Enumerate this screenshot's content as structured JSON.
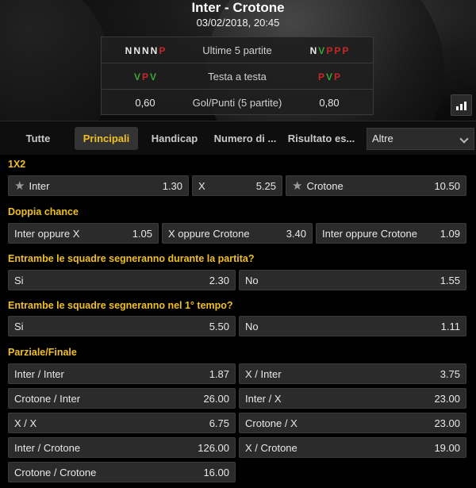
{
  "header": {
    "title": "Inter - Crotone",
    "date": "03/02/2018, 20:45",
    "stats": [
      {
        "label": "Ultime 5 partite",
        "home": [
          "N",
          "N",
          "N",
          "N",
          "P"
        ],
        "away": [
          "N",
          "V",
          "P",
          "P",
          "P"
        ]
      },
      {
        "label": "Testa a testa",
        "home": [
          "V",
          "P",
          "V"
        ],
        "away": [
          "P",
          "V",
          "P"
        ]
      },
      {
        "label": "Gol/Punti (5 partite)",
        "home_value": "0,60",
        "away_value": "0,80"
      }
    ],
    "form_colors": {
      "N": "#e8e8e8",
      "V": "#3aa63a",
      "P": "#c62828"
    }
  },
  "tabs": [
    "Tutte",
    "Principali",
    "Handicap",
    "Numero di ...",
    "Risultato es..."
  ],
  "active_tab": "Principali",
  "select": {
    "value": "Altre"
  },
  "markets": {
    "m1x2": {
      "title": "1X2",
      "options": [
        {
          "name": "Inter",
          "odd": "1.30"
        },
        {
          "name": "X",
          "odd": "5.25"
        },
        {
          "name": "Crotone",
          "odd": "10.50"
        }
      ]
    },
    "doppia": {
      "title": "Doppia chance",
      "options": [
        {
          "name": "Inter oppure X",
          "odd": "1.05"
        },
        {
          "name": "X oppure Crotone",
          "odd": "3.40"
        },
        {
          "name": "Inter oppure Crotone",
          "odd": "1.09"
        }
      ]
    },
    "btts": {
      "title": "Entrambe le squadre segneranno durante la partita?",
      "options": [
        {
          "name": "Si",
          "odd": "2.30"
        },
        {
          "name": "No",
          "odd": "1.55"
        }
      ]
    },
    "btts1": {
      "title": "Entrambe le squadre segneranno nel 1° tempo?",
      "options": [
        {
          "name": "Si",
          "odd": "5.50"
        },
        {
          "name": "No",
          "odd": "1.11"
        }
      ]
    },
    "htft": {
      "title": "Parziale/Finale",
      "options": [
        {
          "name": "Inter / Inter",
          "odd": "1.87"
        },
        {
          "name": "X / Inter",
          "odd": "3.75"
        },
        {
          "name": "Crotone / Inter",
          "odd": "26.00"
        },
        {
          "name": "Inter / X",
          "odd": "23.00"
        },
        {
          "name": "X / X",
          "odd": "6.75"
        },
        {
          "name": "Crotone / X",
          "odd": "23.00"
        },
        {
          "name": "Inter / Crotone",
          "odd": "126.00"
        },
        {
          "name": "X / Crotone",
          "odd": "19.00"
        },
        {
          "name": "Crotone / Crotone",
          "odd": "16.00"
        }
      ]
    }
  }
}
